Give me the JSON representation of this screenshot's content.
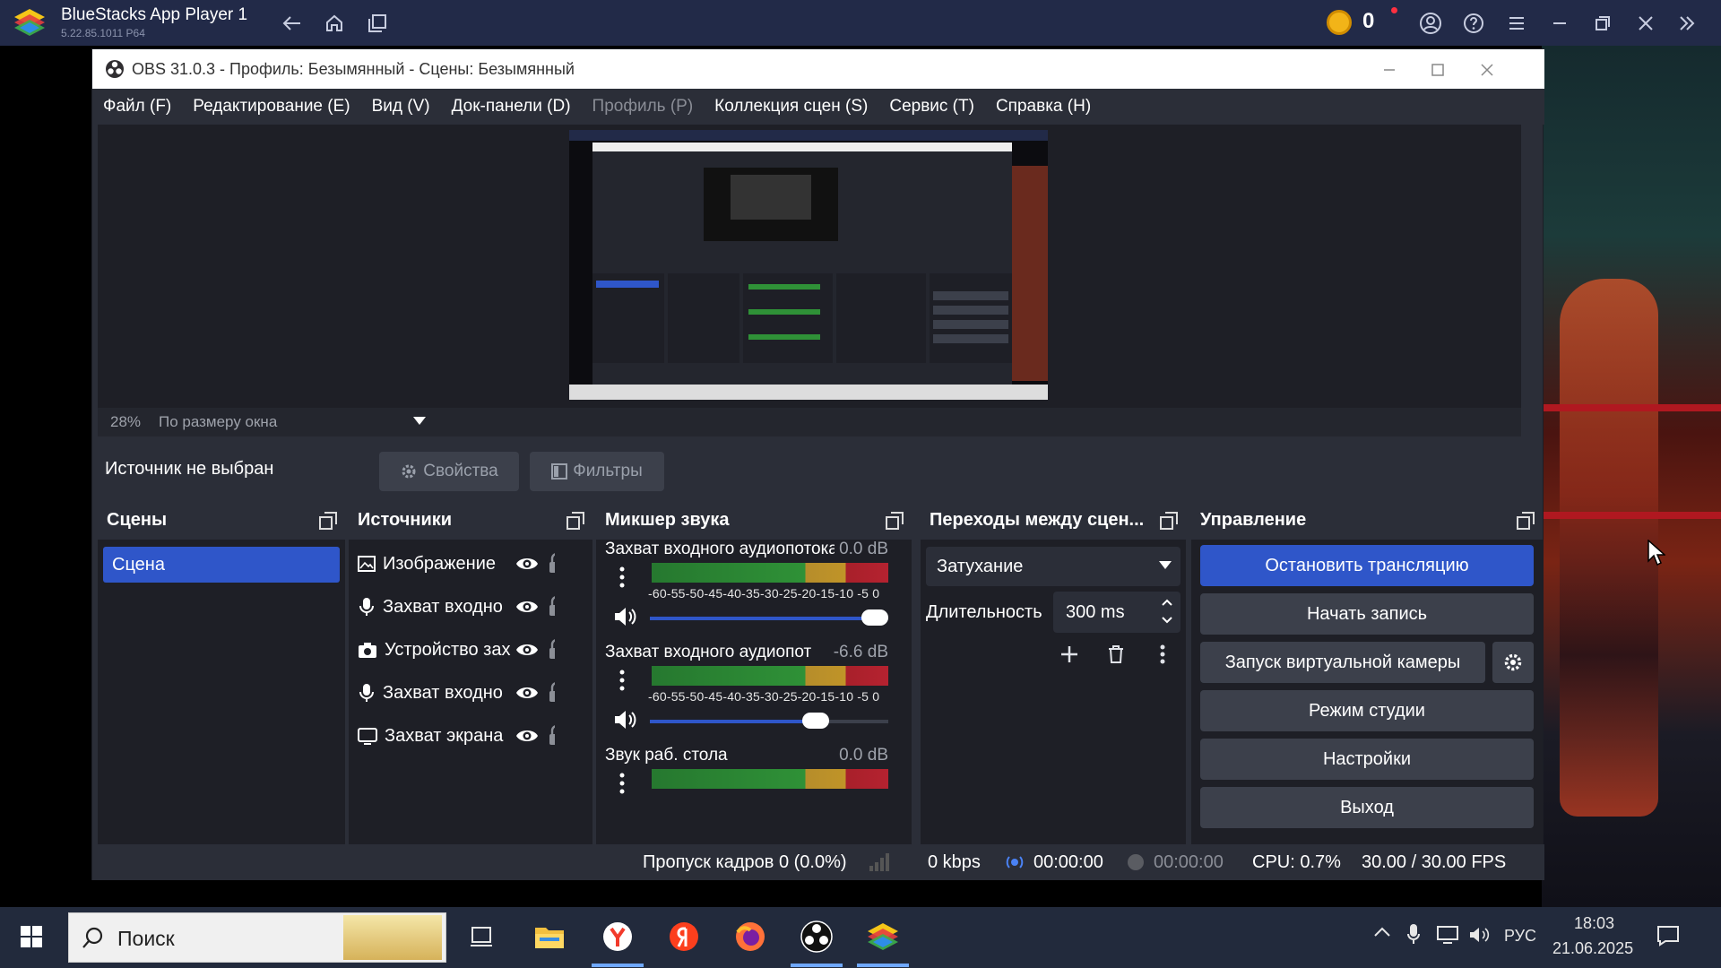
{
  "bluestacks": {
    "title": "BlueStacks App Player 1",
    "version": "5.22.85.1011  P64",
    "coin_count": "0",
    "icons": [
      "back-arrow-icon",
      "home-icon",
      "multi-instance-icon",
      "account-icon",
      "help-icon",
      "menu-icon",
      "minimize-icon",
      "restore-icon",
      "close-icon",
      "double-chevron-right-icon"
    ]
  },
  "obs": {
    "window_title": "OBS 31.0.3 - Профиль: Безымянный - Сцены: Безымянный",
    "menu": [
      {
        "label": "Файл (F)"
      },
      {
        "label": "Редактирование (E)"
      },
      {
        "label": "Вид (V)"
      },
      {
        "label": "Док-панели (D)"
      },
      {
        "label": "Профиль (P)",
        "disabled": true
      },
      {
        "label": "Коллекция сцен (S)"
      },
      {
        "label": "Сервис (T)"
      },
      {
        "label": "Справка (H)"
      }
    ],
    "preview": {
      "zoom": "28%",
      "scale_mode": "По размеру окна"
    },
    "controls_bar": {
      "no_source": "Источник не выбран",
      "properties": "Свойства",
      "filters": "Фильтры"
    },
    "docks": {
      "scenes": {
        "title": "Сцены",
        "items": [
          {
            "label": "Сцена",
            "selected": true
          }
        ]
      },
      "sources": {
        "title": "Источники",
        "items": [
          {
            "label": "Изображение",
            "icon": "image-icon"
          },
          {
            "label": "Захват входно",
            "icon": "microphone-icon"
          },
          {
            "label": "Устройство зах",
            "icon": "camera-icon"
          },
          {
            "label": "Захват входно",
            "icon": "microphone-icon"
          },
          {
            "label": "Захват экрана",
            "icon": "monitor-icon"
          }
        ]
      },
      "mixer": {
        "title": "Микшер звука",
        "scale": "-60-55-50-45-40-35-30-25-20-15-10 -5  0",
        "channels": [
          {
            "name": "Захват входного аудиопотока",
            "db": "0.0 dB",
            "volume": 1.0
          },
          {
            "name": "Захват входного аудиопот",
            "db": "-6.6 dB",
            "volume": 0.72
          },
          {
            "name": "Звук раб. стола",
            "db": "0.0 dB",
            "volume": 1.0
          }
        ]
      },
      "transitions": {
        "title": "Переходы между сцен...",
        "selected": "Затухание",
        "duration_label": "Длительность",
        "duration_value": "300 ms"
      },
      "controls": {
        "title": "Управление",
        "stop_stream": "Остановить трансляцию",
        "start_record": "Начать запись",
        "virtual_cam": "Запуск виртуальной камеры",
        "studio_mode": "Режим студии",
        "settings": "Настройки",
        "exit": "Выход"
      }
    },
    "status": {
      "dropped_frames": "Пропуск кадров 0 (0.0%)",
      "bitrate": "0 kbps",
      "stream_time": "00:00:00",
      "record_time": "00:00:00",
      "cpu": "CPU: 0.7%",
      "fps": "30.00 / 30.00 FPS"
    },
    "colors": {
      "accent": "#2f56c9",
      "panel": "#2b2e38",
      "dock_bg": "#1e1f26"
    }
  },
  "taskbar": {
    "search_placeholder": "Поиск",
    "apps": [
      "task-view-icon",
      "file-explorer-icon",
      "yandex-browser-icon",
      "yandex-icon",
      "firefox-icon",
      "obs-studio-icon",
      "bluestacks-icon"
    ],
    "lang": "РУС",
    "time": "18:03",
    "date": "21.06.2025"
  }
}
